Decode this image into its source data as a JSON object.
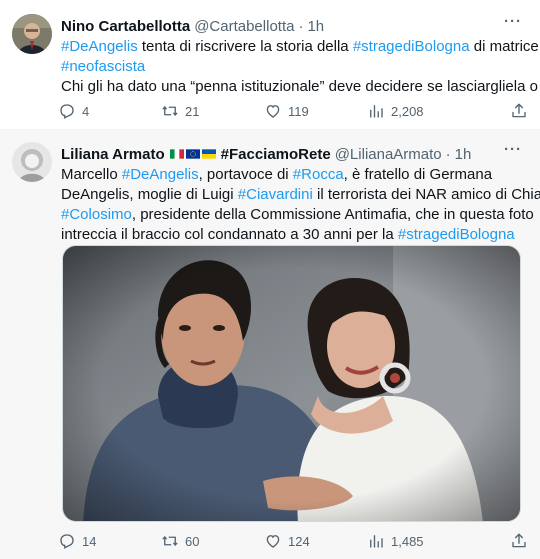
{
  "tweets": [
    {
      "author_name": "Nino Cartabellotta",
      "handle": "@Cartabellotta",
      "dot": "·",
      "time": "1h",
      "line1_tag1": "#DeAngelis",
      "line1_text1": " tenta di riscrivere la storia della ",
      "line1_tag2": "#stragediBologna",
      "line1_text2": " di matrice",
      "line2_tag": "#neofascista",
      "line3_text": "Chi gli ha dato una “penna istituzionale” deve decidere se lasciargliela o no",
      "replies": "4",
      "retweets": "21",
      "likes": "119",
      "views": "2,208"
    },
    {
      "author_name": "Liliana Armato",
      "handle": "@LilianaArmato",
      "dot": "·",
      "time": "1h",
      "name_suffix": "#FacciamoRete",
      "l1a": "Marcello ",
      "l1tag1": "#DeAngelis",
      "l1b": ", portavoce di ",
      "l1tag2": "#Rocca",
      "l1c": ", è fratello di Germana",
      "l2a": "DeAngelis, moglie di Luigi ",
      "l2tag": "#Ciavardini",
      "l2b": " il terrorista dei NAR amico di Chiara",
      "l3tag": "#Colosimo",
      "l3a": ", presidente della Commissione Antimafia, che in questa foto",
      "l4a": "intreccia il braccio col condannato a 30 anni per la ",
      "l4tag": "#stragediBologna",
      "replies": "14",
      "retweets": "60",
      "likes": "124",
      "views": "1,485"
    }
  ],
  "colors": {
    "link": "#1d9bf0",
    "muted": "#536471",
    "text": "#0f1419"
  },
  "icons": [
    "more-icon",
    "reply-icon",
    "retweet-icon",
    "like-icon",
    "views-icon",
    "share-icon"
  ]
}
